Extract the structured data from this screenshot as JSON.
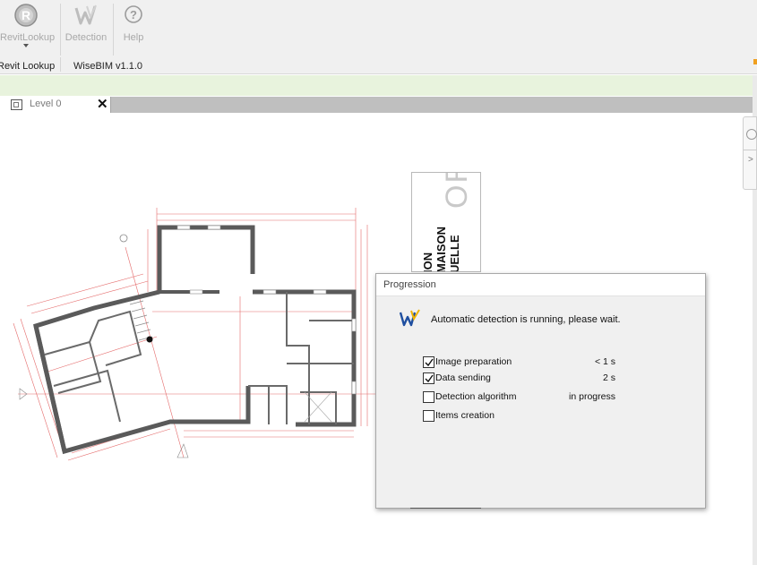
{
  "ribbon": {
    "buttons": [
      {
        "label": "RevitLookup",
        "icon": "revitlookup-r-icon"
      },
      {
        "label": "Detection",
        "icon": "wisebim-logo-icon"
      },
      {
        "label": "Help",
        "icon": "help-question-icon"
      }
    ],
    "groups": [
      {
        "label": "Revit Lookup"
      },
      {
        "label": "WiseBIM v1.1.0"
      }
    ]
  },
  "view_tab": {
    "label": "Level 0",
    "close_glyph": "✕",
    "icon": "floor-plan-view-icon"
  },
  "title_block": {
    "large_letters": "OR",
    "lines": [
      "ION",
      "MAISON",
      "UELLE"
    ]
  },
  "dialog": {
    "title": "Progression",
    "logo_icon": "wisebim-logo-icon",
    "message": "Automatic detection is running, please wait.",
    "steps": [
      {
        "label": "Image preparation",
        "checked": true,
        "status": "< 1 s"
      },
      {
        "label": "Data sending",
        "checked": true,
        "status": "2 s"
      },
      {
        "label": "Detection algorithm",
        "checked": false,
        "status": "in progress"
      },
      {
        "label": "Items creation",
        "checked": false,
        "status": ""
      }
    ]
  },
  "colors": {
    "ribbon_bg": "#f0f0f0",
    "info_bar": "#e8f3dd",
    "tab_strip": "#bfbfbf",
    "plan_walls": "#5a5a5a",
    "plan_dimensions": "#e05050",
    "dialog_bg": "#f0f0f0",
    "logo_blue": "#1f4fa0",
    "logo_yellow": "#f0b400"
  }
}
